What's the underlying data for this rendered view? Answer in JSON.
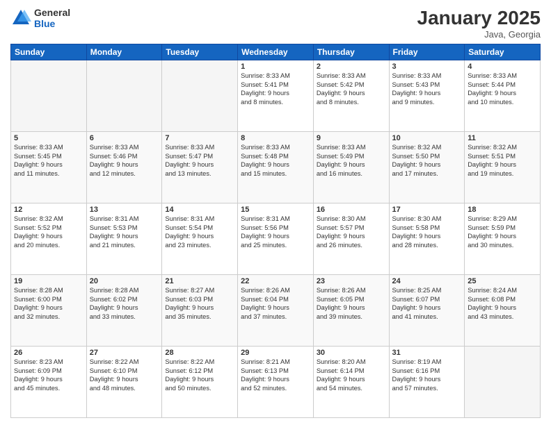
{
  "logo": {
    "line1": "General",
    "line2": "Blue"
  },
  "title": "January 2025",
  "subtitle": "Java, Georgia",
  "days_of_week": [
    "Sunday",
    "Monday",
    "Tuesday",
    "Wednesday",
    "Thursday",
    "Friday",
    "Saturday"
  ],
  "weeks": [
    [
      {
        "day": "",
        "text": ""
      },
      {
        "day": "",
        "text": ""
      },
      {
        "day": "",
        "text": ""
      },
      {
        "day": "1",
        "text": "Sunrise: 8:33 AM\nSunset: 5:41 PM\nDaylight: 9 hours\nand 8 minutes."
      },
      {
        "day": "2",
        "text": "Sunrise: 8:33 AM\nSunset: 5:42 PM\nDaylight: 9 hours\nand 8 minutes."
      },
      {
        "day": "3",
        "text": "Sunrise: 8:33 AM\nSunset: 5:43 PM\nDaylight: 9 hours\nand 9 minutes."
      },
      {
        "day": "4",
        "text": "Sunrise: 8:33 AM\nSunset: 5:44 PM\nDaylight: 9 hours\nand 10 minutes."
      }
    ],
    [
      {
        "day": "5",
        "text": "Sunrise: 8:33 AM\nSunset: 5:45 PM\nDaylight: 9 hours\nand 11 minutes."
      },
      {
        "day": "6",
        "text": "Sunrise: 8:33 AM\nSunset: 5:46 PM\nDaylight: 9 hours\nand 12 minutes."
      },
      {
        "day": "7",
        "text": "Sunrise: 8:33 AM\nSunset: 5:47 PM\nDaylight: 9 hours\nand 13 minutes."
      },
      {
        "day": "8",
        "text": "Sunrise: 8:33 AM\nSunset: 5:48 PM\nDaylight: 9 hours\nand 15 minutes."
      },
      {
        "day": "9",
        "text": "Sunrise: 8:33 AM\nSunset: 5:49 PM\nDaylight: 9 hours\nand 16 minutes."
      },
      {
        "day": "10",
        "text": "Sunrise: 8:32 AM\nSunset: 5:50 PM\nDaylight: 9 hours\nand 17 minutes."
      },
      {
        "day": "11",
        "text": "Sunrise: 8:32 AM\nSunset: 5:51 PM\nDaylight: 9 hours\nand 19 minutes."
      }
    ],
    [
      {
        "day": "12",
        "text": "Sunrise: 8:32 AM\nSunset: 5:52 PM\nDaylight: 9 hours\nand 20 minutes."
      },
      {
        "day": "13",
        "text": "Sunrise: 8:31 AM\nSunset: 5:53 PM\nDaylight: 9 hours\nand 21 minutes."
      },
      {
        "day": "14",
        "text": "Sunrise: 8:31 AM\nSunset: 5:54 PM\nDaylight: 9 hours\nand 23 minutes."
      },
      {
        "day": "15",
        "text": "Sunrise: 8:31 AM\nSunset: 5:56 PM\nDaylight: 9 hours\nand 25 minutes."
      },
      {
        "day": "16",
        "text": "Sunrise: 8:30 AM\nSunset: 5:57 PM\nDaylight: 9 hours\nand 26 minutes."
      },
      {
        "day": "17",
        "text": "Sunrise: 8:30 AM\nSunset: 5:58 PM\nDaylight: 9 hours\nand 28 minutes."
      },
      {
        "day": "18",
        "text": "Sunrise: 8:29 AM\nSunset: 5:59 PM\nDaylight: 9 hours\nand 30 minutes."
      }
    ],
    [
      {
        "day": "19",
        "text": "Sunrise: 8:28 AM\nSunset: 6:00 PM\nDaylight: 9 hours\nand 32 minutes."
      },
      {
        "day": "20",
        "text": "Sunrise: 8:28 AM\nSunset: 6:02 PM\nDaylight: 9 hours\nand 33 minutes."
      },
      {
        "day": "21",
        "text": "Sunrise: 8:27 AM\nSunset: 6:03 PM\nDaylight: 9 hours\nand 35 minutes."
      },
      {
        "day": "22",
        "text": "Sunrise: 8:26 AM\nSunset: 6:04 PM\nDaylight: 9 hours\nand 37 minutes."
      },
      {
        "day": "23",
        "text": "Sunrise: 8:26 AM\nSunset: 6:05 PM\nDaylight: 9 hours\nand 39 minutes."
      },
      {
        "day": "24",
        "text": "Sunrise: 8:25 AM\nSunset: 6:07 PM\nDaylight: 9 hours\nand 41 minutes."
      },
      {
        "day": "25",
        "text": "Sunrise: 8:24 AM\nSunset: 6:08 PM\nDaylight: 9 hours\nand 43 minutes."
      }
    ],
    [
      {
        "day": "26",
        "text": "Sunrise: 8:23 AM\nSunset: 6:09 PM\nDaylight: 9 hours\nand 45 minutes."
      },
      {
        "day": "27",
        "text": "Sunrise: 8:22 AM\nSunset: 6:10 PM\nDaylight: 9 hours\nand 48 minutes."
      },
      {
        "day": "28",
        "text": "Sunrise: 8:22 AM\nSunset: 6:12 PM\nDaylight: 9 hours\nand 50 minutes."
      },
      {
        "day": "29",
        "text": "Sunrise: 8:21 AM\nSunset: 6:13 PM\nDaylight: 9 hours\nand 52 minutes."
      },
      {
        "day": "30",
        "text": "Sunrise: 8:20 AM\nSunset: 6:14 PM\nDaylight: 9 hours\nand 54 minutes."
      },
      {
        "day": "31",
        "text": "Sunrise: 8:19 AM\nSunset: 6:16 PM\nDaylight: 9 hours\nand 57 minutes."
      },
      {
        "day": "",
        "text": ""
      }
    ]
  ]
}
